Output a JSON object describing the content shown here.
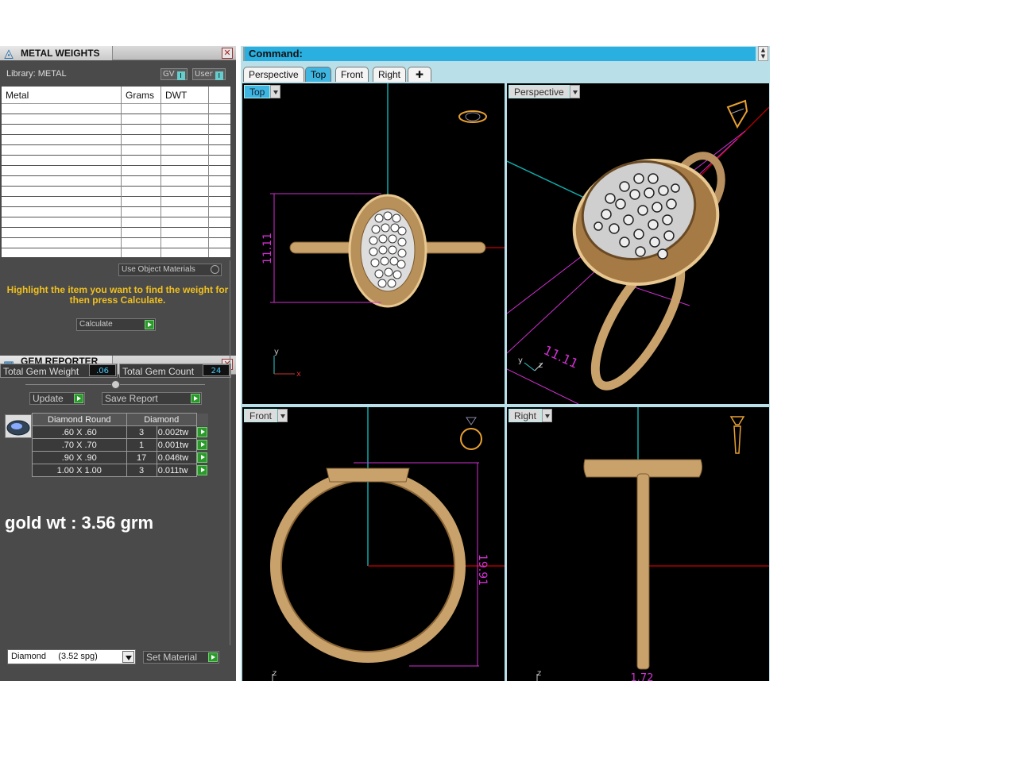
{
  "metal_panel": {
    "title": "METAL WEIGHTS",
    "library": "Library: METAL",
    "gv_label": "GV",
    "user_label": "User",
    "columns": [
      "Metal",
      "Grams",
      "DWT"
    ],
    "use_object_materials": "Use Object Materials",
    "hint": "Highlight the item you want to find the weight for then press Calculate.",
    "calculate": "Calculate"
  },
  "gem_panel": {
    "title": "GEM REPORTER",
    "total_weight_label": "Total Gem Weight",
    "total_weight_value": ".06",
    "total_count_label": "Total Gem Count",
    "total_count_value": "24",
    "update": "Update",
    "save_report": "Save Report",
    "table_headers": [
      "Diamond Round",
      "Diamond"
    ],
    "rows": [
      {
        "size": ".60 X .60",
        "count": "3",
        "weight": "0.002tw"
      },
      {
        "size": ".70 X .70",
        "count": "1",
        "weight": "0.001tw"
      },
      {
        "size": ".90 X .90",
        "count": "17",
        "weight": "0.046tw"
      },
      {
        "size": "1.00 X 1.00",
        "count": "3",
        "weight": "0.011tw"
      }
    ],
    "gold_wt": "gold wt : 3.56 grm",
    "material_select": "Diamond     (3.52 spg)",
    "set_material": "Set Material"
  },
  "command": {
    "label": "Command:"
  },
  "view_tabs": [
    "Perspective",
    "Top",
    "Front",
    "Right"
  ],
  "active_tab": "Top",
  "viewports": {
    "top": {
      "label": "Top",
      "dimension": "11.11",
      "axis_y": "y",
      "axis_x": "x"
    },
    "perspective": {
      "label": "Perspective",
      "dimension": "11.11",
      "axis_y": "y",
      "axis_z": "z"
    },
    "front": {
      "label": "Front",
      "dimension": "19.91",
      "axis_z": "z"
    },
    "right": {
      "label": "Right",
      "dimension": "1.72",
      "axis_z": "z"
    }
  },
  "colors": {
    "panel": "#4a4a4a",
    "accent": "#3fb6e2",
    "gold": "#c9a26b",
    "dimension": "#d030d0",
    "hint": "#f0c020"
  }
}
